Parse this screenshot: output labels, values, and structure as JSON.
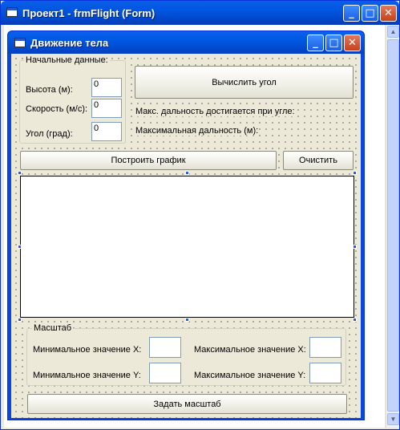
{
  "outer_window": {
    "title": "Проект1 - frmFlight (Form)"
  },
  "form": {
    "title": "Движение тела"
  },
  "initial_data": {
    "caption": "Начальные данные:",
    "height_label": "Высота (м):",
    "height_value": "0",
    "speed_label": "Скорость (м/с):",
    "speed_value": "0",
    "angle_label": "Угол (град):",
    "angle_value": "0"
  },
  "compute": {
    "button_label": "Вычислить угол",
    "max_range_angle_label": "Макс. дальность достигается при угле:",
    "max_range_label": "Максимальная дальность (м):"
  },
  "plot": {
    "build_label": "Построить график",
    "clear_label": "Очистить"
  },
  "scale": {
    "caption": "Масштаб",
    "min_x_label": "Минимальное значение X:",
    "max_x_label": "Максимальное значение X:",
    "min_y_label": "Минимальное значение Y:",
    "max_y_label": "Максимальное значение Y:",
    "set_label": "Задать масштаб"
  }
}
